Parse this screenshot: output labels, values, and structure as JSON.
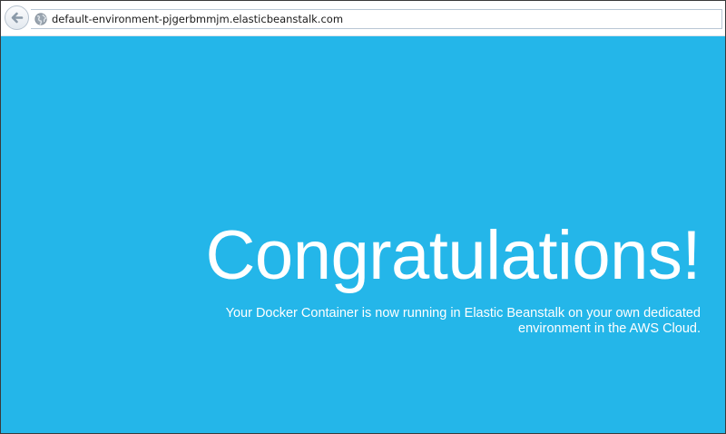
{
  "browser": {
    "url": "default-environment-pjgerbmmjm.elasticbeanstalk.com",
    "back_icon": "back-arrow-icon",
    "site_icon": "globe-icon"
  },
  "page": {
    "headline": "Congratulations!",
    "message_lines": [
      "Your Docker Container is now running in Elastic Beanstalk on your own dedicated",
      "environment in the AWS Cloud."
    ]
  },
  "colors": {
    "page_background": "#24b6e9",
    "text": "#ffffff"
  }
}
